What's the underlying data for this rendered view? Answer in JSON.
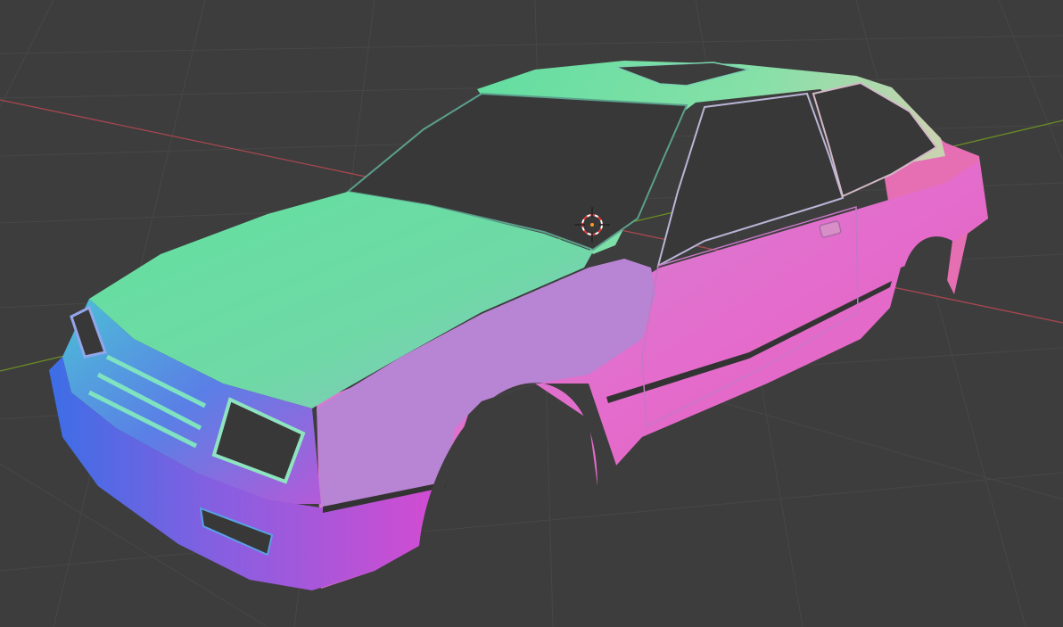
{
  "viewport": {
    "background": "#3d3d3d",
    "grid_color": "#4a4a4a",
    "x_axis_color": "#b0484f",
    "y_axis_color": "#6b8e23",
    "object": "car-body-shell",
    "shading": "normal-map",
    "has_3d_cursor": true
  }
}
